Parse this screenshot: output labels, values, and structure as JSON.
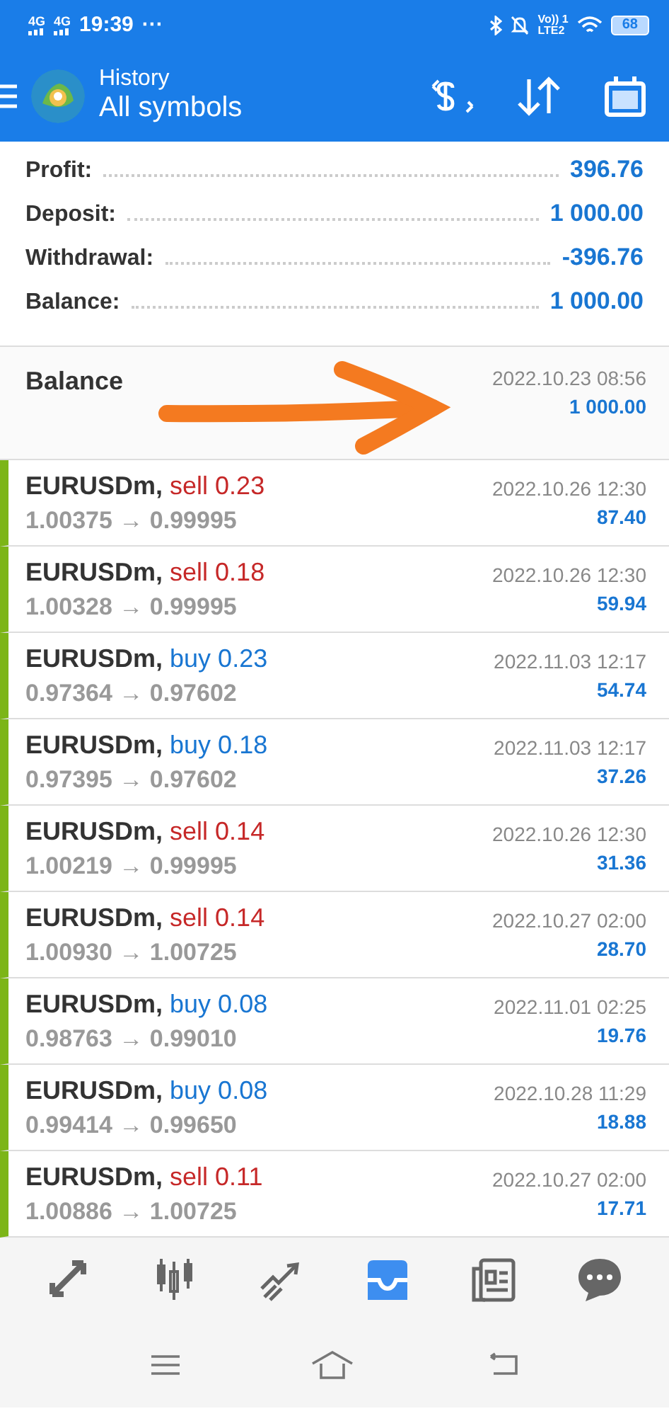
{
  "status_bar": {
    "networks": [
      "4G",
      "4G"
    ],
    "time": "19:39",
    "more": "···",
    "volte_top": "Vo)) 1",
    "volte_bottom": "LTE2",
    "battery": "68"
  },
  "app_bar": {
    "subtitle": "History",
    "title": "All symbols"
  },
  "summary": [
    {
      "label": "Profit:",
      "value": "396.76"
    },
    {
      "label": "Deposit:",
      "value": "1 000.00"
    },
    {
      "label": "Withdrawal:",
      "value": "-396.76"
    },
    {
      "label": "Balance:",
      "value": "1 000.00"
    }
  ],
  "balance_entry": {
    "label": "Balance",
    "time": "2022.10.23 08:56",
    "amount": "1 000.00"
  },
  "deals": [
    {
      "symbol": "EURUSDm,",
      "action": "sell 0.23",
      "color": "#c62828",
      "prices": "1.00375 → 0.99995",
      "time": "2022.10.26 12:30",
      "profit": "87.40"
    },
    {
      "symbol": "EURUSDm,",
      "action": "sell 0.18",
      "color": "#c62828",
      "prices": "1.00328 → 0.99995",
      "time": "2022.10.26 12:30",
      "profit": "59.94"
    },
    {
      "symbol": "EURUSDm,",
      "action": "buy 0.23",
      "color": "#1976d2",
      "prices": "0.97364 → 0.97602",
      "time": "2022.11.03 12:17",
      "profit": "54.74"
    },
    {
      "symbol": "EURUSDm,",
      "action": "buy 0.18",
      "color": "#1976d2",
      "prices": "0.97395 → 0.97602",
      "time": "2022.11.03 12:17",
      "profit": "37.26"
    },
    {
      "symbol": "EURUSDm,",
      "action": "sell 0.14",
      "color": "#c62828",
      "prices": "1.00219 → 0.99995",
      "time": "2022.10.26 12:30",
      "profit": "31.36"
    },
    {
      "symbol": "EURUSDm,",
      "action": "sell 0.14",
      "color": "#c62828",
      "prices": "1.00930 → 1.00725",
      "time": "2022.10.27 02:00",
      "profit": "28.70"
    },
    {
      "symbol": "EURUSDm,",
      "action": "buy 0.08",
      "color": "#1976d2",
      "prices": "0.98763 → 0.99010",
      "time": "2022.11.01 02:25",
      "profit": "19.76"
    },
    {
      "symbol": "EURUSDm,",
      "action": "buy 0.08",
      "color": "#1976d2",
      "prices": "0.99414 → 0.99650",
      "time": "2022.10.28 11:29",
      "profit": "18.88"
    },
    {
      "symbol": "EURUSDm,",
      "action": "sell 0.11",
      "color": "#c62828",
      "prices": "1.00886 → 1.00725",
      "time": "2022.10.27 02:00",
      "profit": "17.71"
    }
  ],
  "bottom_nav": [
    {
      "kind": "quotes",
      "selected": false
    },
    {
      "kind": "chart",
      "selected": false
    },
    {
      "kind": "trade",
      "selected": false
    },
    {
      "kind": "history",
      "selected": true
    },
    {
      "kind": "news",
      "selected": false
    },
    {
      "kind": "chat",
      "selected": false
    }
  ]
}
